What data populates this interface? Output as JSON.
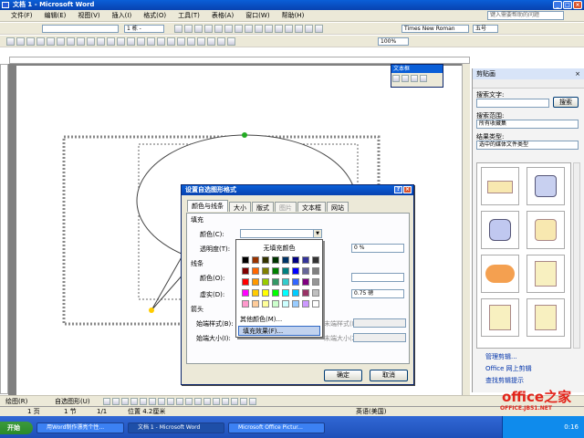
{
  "window": {
    "title": "文档 1 - Microsoft Word"
  },
  "menu": {
    "items": [
      "文件(F)",
      "编辑(E)",
      "视图(V)",
      "插入(I)",
      "格式(O)",
      "工具(T)",
      "表格(A)",
      "窗口(W)",
      "帮助(H)"
    ],
    "help_placeholder": "键入需要帮助的问题"
  },
  "toolbar": {
    "font_name": "Times New Roman",
    "font_size": "五号",
    "style": "",
    "zoom": "100%",
    "style_combo": "1 栋 -"
  },
  "textbox_toolbar": {
    "title": "文本框"
  },
  "dialog": {
    "title": "设置自选图形格式",
    "tabs": [
      "颜色与线条",
      "大小",
      "版式",
      "图片",
      "文本框",
      "网站"
    ],
    "fill_section": "填充",
    "color_label": "颜色(C):",
    "transparency_label": "透明度(T):",
    "transparency_value": "0 %",
    "line_section": "线条",
    "line_color_label": "颜色(O):",
    "dash_label": "虚实(D):",
    "line_weight_value": "0.75 磅",
    "arrows_section": "箭头",
    "begin_style_label": "始端样式(B):",
    "begin_size_label": "始端大小(I):",
    "end_style_label": "末端样式(E):",
    "end_size_label": "末端大小(Z):",
    "ok": "确定",
    "cancel": "取消"
  },
  "color_popup": {
    "no_fill": "无填充颜色",
    "more_colors": "其他颜色(M)...",
    "fill_effects": "填充效果(F)...",
    "colors": [
      "#000000",
      "#993300",
      "#333300",
      "#003300",
      "#003366",
      "#000080",
      "#333399",
      "#333333",
      "#800000",
      "#ff6600",
      "#808000",
      "#008000",
      "#008080",
      "#0000ff",
      "#666699",
      "#808080",
      "#ff0000",
      "#ff9900",
      "#99cc00",
      "#339966",
      "#33cccc",
      "#3366ff",
      "#800080",
      "#969696",
      "#ff00ff",
      "#ffcc00",
      "#ffff00",
      "#00ff00",
      "#00ffff",
      "#00ccff",
      "#993366",
      "#c0c0c0",
      "#ff99cc",
      "#ffcc99",
      "#ffff99",
      "#ccffcc",
      "#ccffff",
      "#99ccff",
      "#cc99ff",
      "#ffffff"
    ]
  },
  "taskpane": {
    "title": "剪贴画",
    "search_label": "搜索文字:",
    "search_button": "搜索",
    "scope_label": "搜索范围:",
    "scope_value": "所有收藏集",
    "type_label": "结果类型:",
    "type_value": "选中的媒体文件类型",
    "links": [
      "管理剪辑...",
      "Office 网上剪辑",
      "查找剪辑提示"
    ]
  },
  "drawbar": {
    "draw": "绘图(R)",
    "autoshapes": "自选图形(U)"
  },
  "statusbar": {
    "page": "1 页",
    "section": "1 节",
    "pages": "1/1",
    "position": "位置 4.2厘米",
    "lang": "英语(美国)"
  },
  "taskbar": {
    "start": "开始",
    "tasks": [
      "用Word制作漂亮个性...",
      "文档 1 - Microsoft Word",
      "Microsoft Office Pictur..."
    ],
    "clock": "0:16"
  },
  "watermark": {
    "brand": "office之家",
    "url": "OFFICE.JB51.NET"
  },
  "colors": {
    "accent": "#0a5fd8",
    "watermark_red": "#e2231a"
  }
}
